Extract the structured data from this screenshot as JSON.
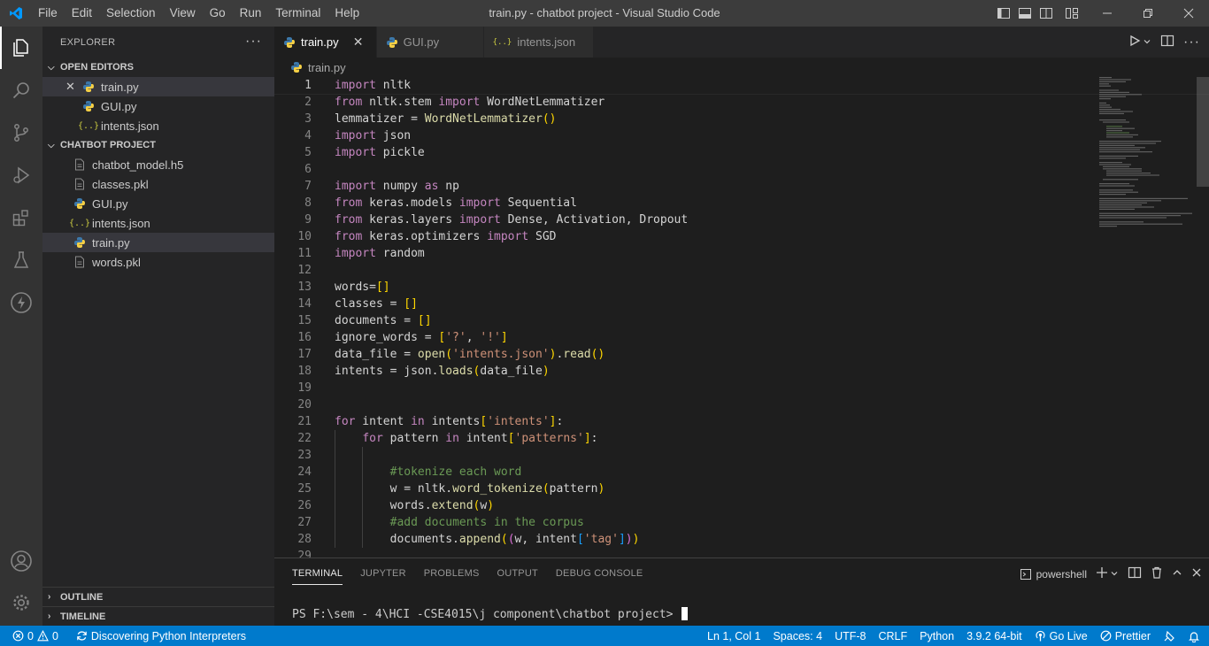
{
  "window": {
    "title": "train.py - chatbot project - Visual Studio Code"
  },
  "menu": [
    "File",
    "Edit",
    "Selection",
    "View",
    "Go",
    "Run",
    "Terminal",
    "Help"
  ],
  "sidebar": {
    "title": "EXPLORER",
    "more_label": "···",
    "open_editors_title": "OPEN EDITORS",
    "open_editors": [
      {
        "name": "train.py",
        "icon": "python-icon"
      },
      {
        "name": "GUI.py",
        "icon": "python-icon"
      },
      {
        "name": "intents.json",
        "icon": "json-icon"
      }
    ],
    "project_title": "CHATBOT PROJECT",
    "project_files": [
      {
        "name": "chatbot_model.h5",
        "icon": "file-icon"
      },
      {
        "name": "classes.pkl",
        "icon": "file-icon"
      },
      {
        "name": "GUI.py",
        "icon": "python-icon"
      },
      {
        "name": "intents.json",
        "icon": "json-icon"
      },
      {
        "name": "train.py",
        "icon": "python-icon"
      },
      {
        "name": "words.pkl",
        "icon": "file-icon"
      }
    ],
    "outline_title": "OUTLINE",
    "timeline_title": "TIMELINE",
    "json_glyph": "{..}"
  },
  "tabs": [
    {
      "label": "train.py",
      "close": "✕"
    },
    {
      "label": "GUI.py"
    },
    {
      "label": "intents.json"
    }
  ],
  "breadcrumb": "train.py",
  "code": {
    "line_numbers": [
      "1",
      "2",
      "3",
      "4",
      "5",
      "6",
      "7",
      "8",
      "9",
      "10",
      "11",
      "12",
      "13",
      "14",
      "15",
      "16",
      "17",
      "18",
      "19",
      "20",
      "21",
      "22",
      "23",
      "24",
      "25",
      "26",
      "27",
      "28",
      "29"
    ],
    "current_line": 1
  },
  "panel": {
    "tabs": [
      "TERMINAL",
      "JUPYTER",
      "PROBLEMS",
      "OUTPUT",
      "DEBUG CONSOLE"
    ],
    "shell": "powershell",
    "prompt": "PS F:\\sem - 4\\HCI -CSE4015\\j component\\chatbot project> "
  },
  "status": {
    "errors": "0",
    "warnings": "0",
    "task": "Discovering Python Interpreters",
    "position": "Ln 1, Col 1",
    "spaces": "Spaces: 4",
    "encoding": "UTF-8",
    "eol": "CRLF",
    "language": "Python",
    "interpreter": "3.9.2 64-bit",
    "go_live": "Go Live",
    "prettier": "Prettier"
  },
  "colors": {
    "titlebar": "#3c3c3c",
    "activitybar": "#333333",
    "sidebar": "#252526",
    "editor": "#1e1e1e",
    "statusbar": "#007acc",
    "keyword": "#c586c0",
    "string": "#ce9178",
    "comment": "#6a9955",
    "function": "#dcdcaa"
  }
}
